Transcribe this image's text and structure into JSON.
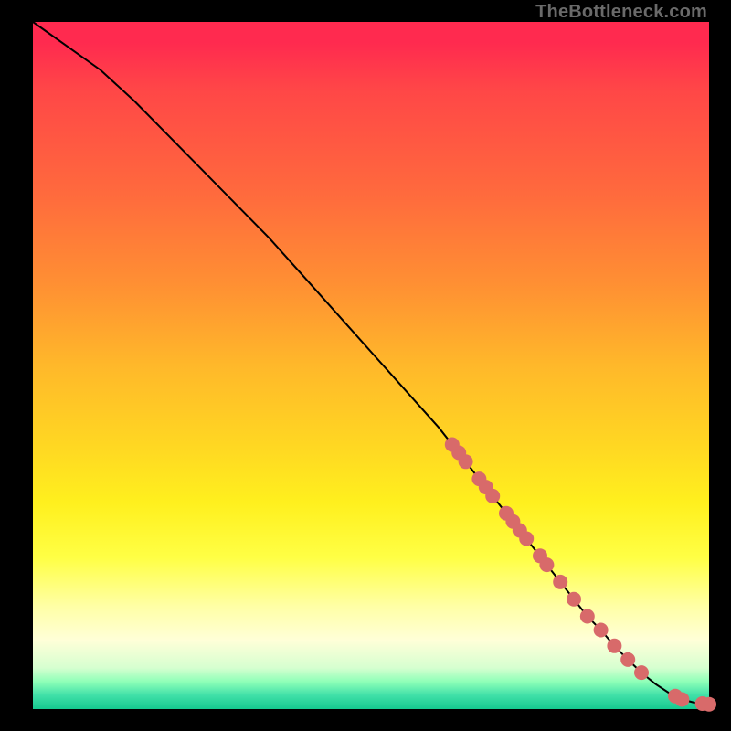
{
  "watermark": "TheBottleneck.com",
  "colors": {
    "marker": "#d86a6a",
    "line": "#000000"
  },
  "chart_data": {
    "type": "line",
    "title": "",
    "xlabel": "",
    "ylabel": "",
    "xlim": [
      0,
      100
    ],
    "ylim": [
      0,
      100
    ],
    "grid": false,
    "legend": false,
    "series": [
      {
        "name": "curve",
        "x": [
          0,
          10,
          15,
          20,
          25,
          30,
          35,
          40,
          45,
          50,
          55,
          60,
          62,
          64,
          66,
          68,
          70,
          72,
          74,
          76,
          78,
          80,
          82,
          84,
          86,
          88,
          90,
          92,
          94,
          96,
          98,
          100
        ],
        "y": [
          100,
          93,
          88.5,
          83.5,
          78.5,
          73.5,
          68.5,
          63,
          57.5,
          52,
          46.5,
          41,
          38.5,
          36,
          33.5,
          31,
          28.5,
          26,
          23.5,
          21,
          18.5,
          16,
          13.5,
          11.5,
          9.2,
          7.2,
          5.3,
          3.7,
          2.4,
          1.4,
          0.9,
          0.7
        ]
      }
    ],
    "markers": {
      "name": "highlighted-points",
      "x": [
        62,
        63,
        64,
        66,
        67,
        68,
        70,
        71,
        72,
        73,
        75,
        76,
        78,
        80,
        82,
        84,
        86,
        88,
        90,
        95,
        96,
        99,
        100
      ],
      "y": [
        38.5,
        37.3,
        36,
        33.5,
        32.3,
        31,
        28.5,
        27.3,
        26,
        24.8,
        22.3,
        21,
        18.5,
        16,
        13.5,
        11.5,
        9.2,
        7.2,
        5.3,
        1.9,
        1.4,
        0.8,
        0.7
      ]
    }
  }
}
